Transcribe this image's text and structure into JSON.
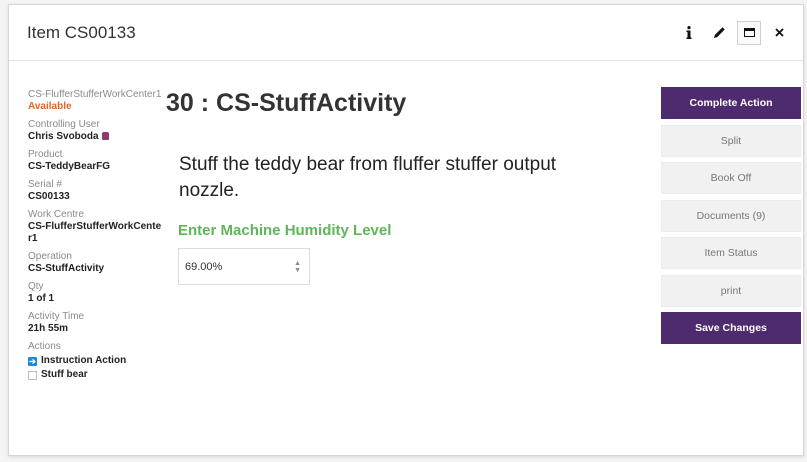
{
  "window": {
    "title": "Item CS00133"
  },
  "header_tools": [
    "info-icon",
    "pencil-icon",
    "window-icon",
    "close-icon"
  ],
  "left_panel": {
    "workcenter_label": "CS-FlufferStufferWorkCenter1",
    "workcenter_status": "Available",
    "controlling_user_label": "Controlling User",
    "controlling_user": "Chris Svoboda",
    "product_label": "Product",
    "product": "CS-TeddyBearFG",
    "serial_label": "Serial #",
    "serial": "CS00133",
    "work_centre_label": "Work Centre",
    "work_centre": "CS-FlufferStufferWorkCenter1",
    "operation_label": "Operation",
    "operation": "CS-StuffActivity",
    "qty_label": "Qty",
    "qty": "1 of 1",
    "activity_time_label": "Activity Time",
    "activity_time": "21h 55m",
    "actions_label": "Actions",
    "actions": [
      "Instruction Action",
      "Stuff bear"
    ]
  },
  "main": {
    "operation_title": "30 : CS-StuffActivity",
    "instruction": "Stuff the teddy bear from fluffer stuffer output nozzle.",
    "prompt_label": "Enter Machine Humidity Level",
    "humidity_value": "69.00%",
    "spinner_up": "▲",
    "spinner_down": "▼"
  },
  "buttons": {
    "complete": "Complete Action",
    "split": "Split",
    "book_off": "Book Off",
    "documents": "Documents (9)",
    "item_status": "Item Status",
    "print": "print",
    "save": "Save Changes"
  },
  "colors": {
    "accent": "#4e2a6e",
    "status": "#e0642c",
    "prompt": "#5fb65a",
    "action_icon": "#1e8ad8"
  }
}
